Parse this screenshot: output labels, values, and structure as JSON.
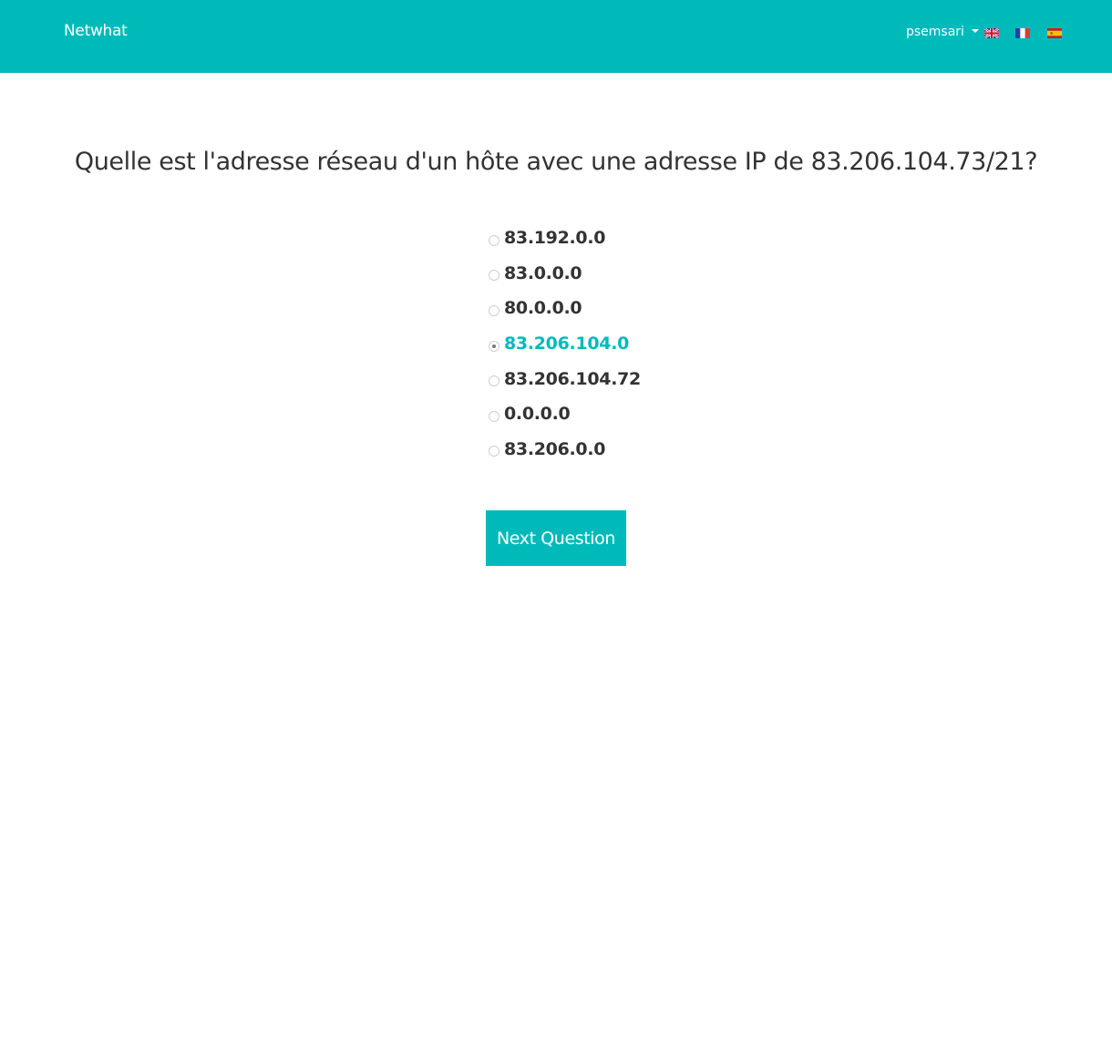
{
  "navbar": {
    "brand": "Netwhat",
    "username": "psemsari",
    "languages": [
      {
        "code": "en",
        "icon": "flag-uk-icon"
      },
      {
        "code": "fr",
        "icon": "flag-fr-icon"
      },
      {
        "code": "es",
        "icon": "flag-es-icon"
      }
    ]
  },
  "quiz": {
    "question": "Quelle est l'adresse réseau d'un hôte avec une adresse IP de 83.206.104.73/21?",
    "answers": [
      {
        "label": "83.192.0.0",
        "selected": false
      },
      {
        "label": "83.0.0.0",
        "selected": false
      },
      {
        "label": "80.0.0.0",
        "selected": false
      },
      {
        "label": "83.206.104.0",
        "selected": true
      },
      {
        "label": "83.206.104.72",
        "selected": false
      },
      {
        "label": "0.0.0.0",
        "selected": false
      },
      {
        "label": "83.206.0.0",
        "selected": false
      }
    ],
    "next_label": "Next Question"
  },
  "colors": {
    "accent": "#00BABA",
    "text": "#333333"
  }
}
